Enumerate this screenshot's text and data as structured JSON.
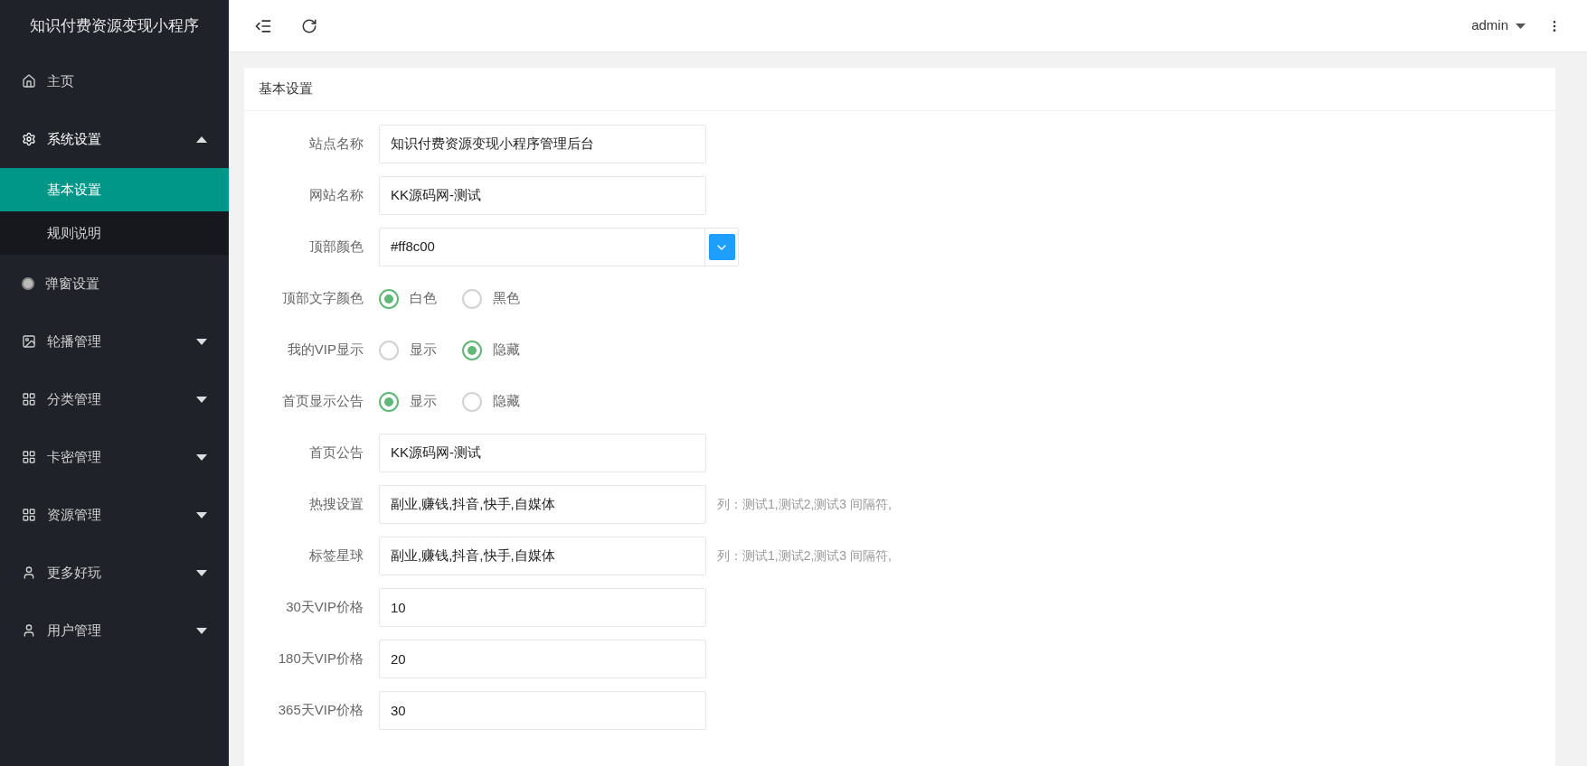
{
  "sidebar": {
    "title": "知识付费资源变现小程序",
    "items": [
      {
        "label": "主页"
      },
      {
        "label": "系统设置",
        "expanded": true,
        "children": [
          {
            "label": "基本设置",
            "selected": true
          },
          {
            "label": "规则说明",
            "selected": false
          }
        ]
      },
      {
        "label": "弹窗设置"
      },
      {
        "label": "轮播管理",
        "expanded": false
      },
      {
        "label": "分类管理",
        "expanded": false
      },
      {
        "label": "卡密管理",
        "expanded": false
      },
      {
        "label": "资源管理",
        "expanded": false
      },
      {
        "label": "更多好玩",
        "expanded": false
      },
      {
        "label": "用户管理",
        "expanded": false
      }
    ]
  },
  "header": {
    "user": "admin"
  },
  "card": {
    "title": "基本设置",
    "fields": [
      {
        "kind": "text",
        "label": "站点名称",
        "value": "知识付费资源变现小程序管理后台"
      },
      {
        "kind": "text",
        "label": "网站名称",
        "value": "KK源码网-测试"
      },
      {
        "kind": "color",
        "label": "顶部颜色",
        "value": "#ff8c00"
      },
      {
        "kind": "radio",
        "label": "顶部文字颜色",
        "options": [
          {
            "label": "白色",
            "selected": true
          },
          {
            "label": "黑色",
            "selected": false
          }
        ]
      },
      {
        "kind": "radio",
        "label": "我的VIP显示",
        "options": [
          {
            "label": "显示",
            "selected": false
          },
          {
            "label": "隐藏",
            "selected": true
          }
        ]
      },
      {
        "kind": "radio",
        "label": "首页显示公告",
        "options": [
          {
            "label": "显示",
            "selected": true
          },
          {
            "label": "隐藏",
            "selected": false
          }
        ]
      },
      {
        "kind": "text",
        "label": "首页公告",
        "value": "KK源码网-测试"
      },
      {
        "kind": "text",
        "label": "热搜设置",
        "value": "副业,赚钱,抖音,快手,自媒体",
        "hint": "列：测试1,测试2,测试3 间隔符,"
      },
      {
        "kind": "text",
        "label": "标签星球",
        "value": "副业,赚钱,抖音,快手,自媒体",
        "hint": "列：测试1,测试2,测试3 间隔符,"
      },
      {
        "kind": "text",
        "label": "30天VIP价格",
        "value": "10"
      },
      {
        "kind": "text",
        "label": "180天VIP价格",
        "value": "20"
      },
      {
        "kind": "text",
        "label": "365天VIP价格",
        "value": "30"
      }
    ]
  }
}
